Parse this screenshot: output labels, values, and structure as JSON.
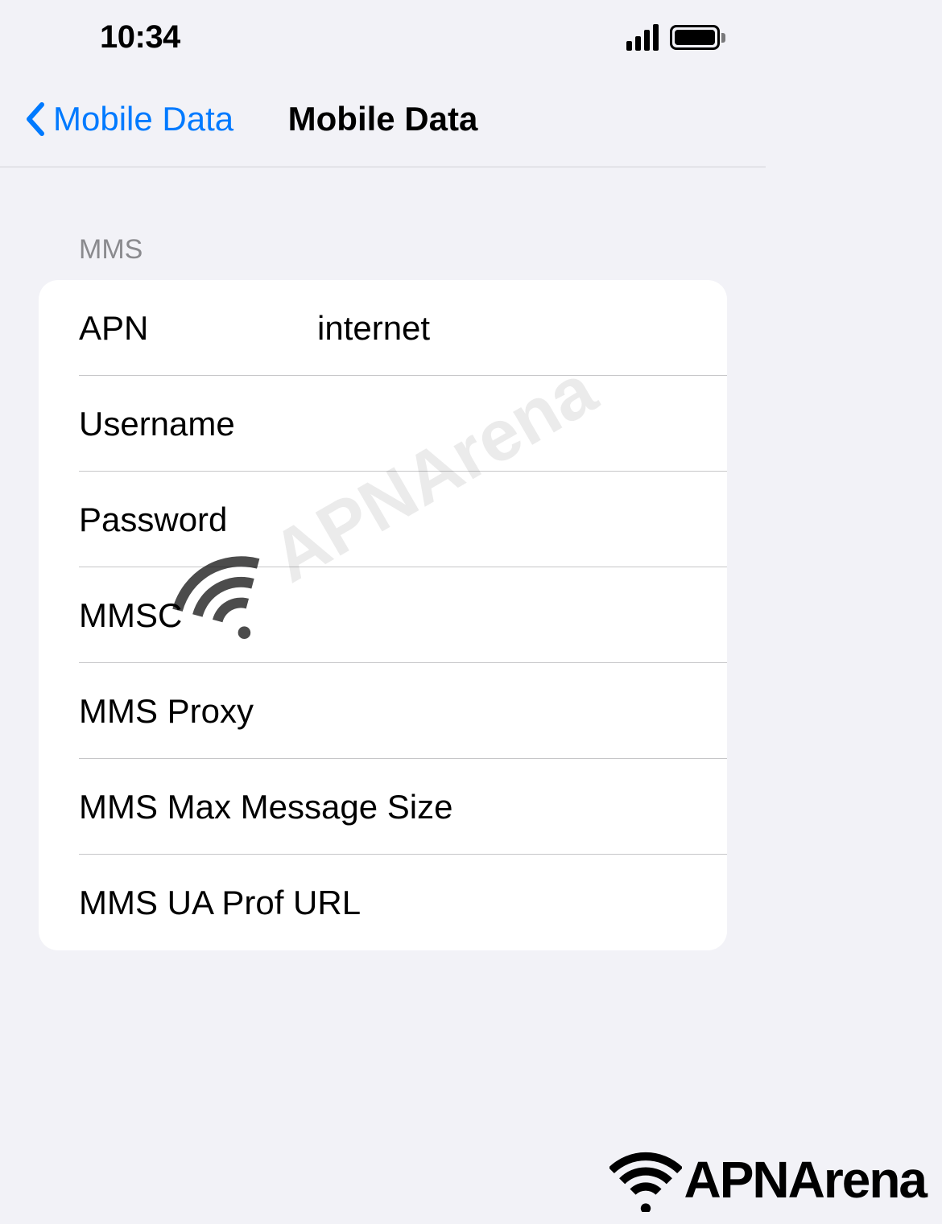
{
  "status_bar": {
    "time": "10:34"
  },
  "nav": {
    "back_label": "Mobile Data",
    "title": "Mobile Data"
  },
  "section": {
    "header": "MMS",
    "rows": [
      {
        "label": "APN",
        "value": "internet"
      },
      {
        "label": "Username",
        "value": ""
      },
      {
        "label": "Password",
        "value": ""
      },
      {
        "label": "MMSC",
        "value": ""
      },
      {
        "label": "MMS Proxy",
        "value": ""
      },
      {
        "label": "MMS Max Message Size",
        "value": ""
      },
      {
        "label": "MMS UA Prof URL",
        "value": ""
      }
    ]
  },
  "branding": {
    "watermark": "APNArena",
    "footer": "APNArena"
  }
}
